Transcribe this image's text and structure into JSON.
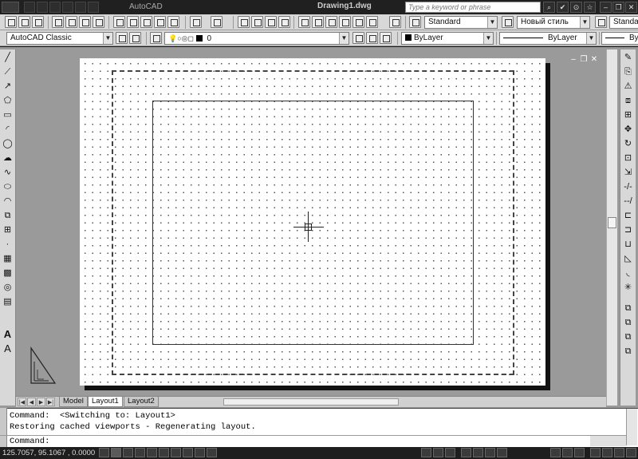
{
  "title_bar": {
    "app_name": "AutoCAD",
    "document_name": "Drawing1.dwg",
    "search_placeholder": "Type a keyword or phrase"
  },
  "toolbar1": {
    "text_style": "Standard",
    "dim_style": "Новый стиль",
    "table_style": "Standard"
  },
  "toolbar2": {
    "workspace": "AutoCAD Classic",
    "layer": "0",
    "color": "ByLayer",
    "linetype": "ByLayer",
    "lineweight": "ByL"
  },
  "layout_tabs": {
    "items": [
      "Model",
      "Layout1",
      "Layout2"
    ],
    "active": "Layout1"
  },
  "command_window": {
    "history": [
      "Command:  <Switching to: Layout1>",
      "Restoring cached viewports - Regenerating layout."
    ],
    "prompt": "Command:"
  },
  "status_bar": {
    "coordinates": "125.7057, 95.1067 , 0.0000"
  },
  "icons": {
    "left_toolbar": [
      "line-icon",
      "construction-line-icon",
      "polyline-icon",
      "polygon-icon",
      "rectangle-icon",
      "arc-icon",
      "circle-icon",
      "revision-cloud-icon",
      "spline-icon",
      "ellipse-icon",
      "ellipse-arc-icon",
      "insert-block-icon",
      "make-block-icon",
      "point-icon",
      "hatch-icon",
      "gradient-icon",
      "region-icon",
      "table-icon",
      "multiline-text-icon"
    ],
    "right_toolbar": [
      "erase-icon",
      "copy-icon",
      "mirror-icon",
      "offset-icon",
      "array-icon",
      "move-icon",
      "rotate-icon",
      "scale-icon",
      "stretch-icon",
      "trim-icon",
      "extend-icon",
      "break-at-point-icon",
      "break-icon",
      "join-icon",
      "chamfer-icon",
      "fillet-icon",
      "explode-icon"
    ]
  }
}
